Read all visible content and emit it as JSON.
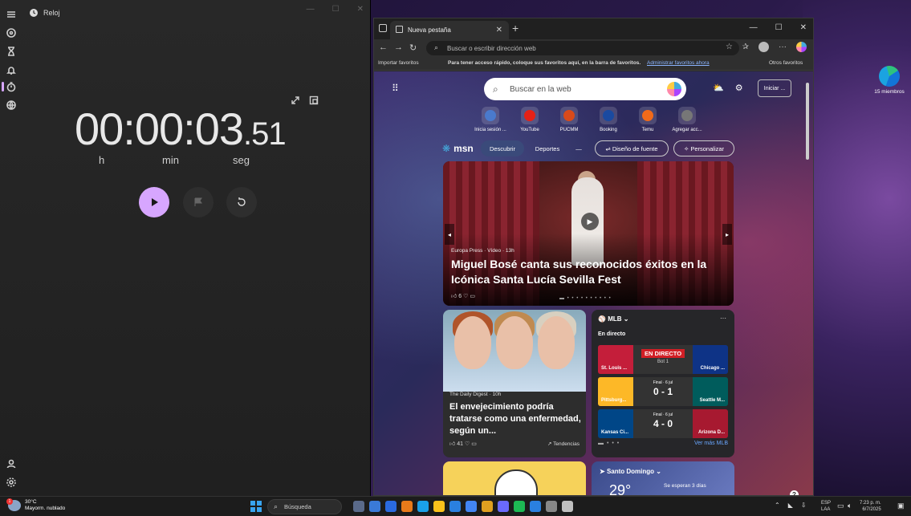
{
  "clock_app": {
    "title": "Reloj",
    "timer": {
      "main": "00:00:03",
      "fraction": ".51"
    },
    "units": {
      "h": "h",
      "min": "min",
      "seg": "seg"
    }
  },
  "browser": {
    "tab_title": "Nueva pestaña",
    "address_placeholder": "Buscar o escribir dirección web",
    "favorites_bar": {
      "import": "Importar favoritos",
      "message": "Para tener acceso rápido, coloque sus favoritos aquí, en la barra de favoritos.",
      "link": "Administrar favoritos ahora",
      "other": "Otros favoritos"
    },
    "search_placeholder": "Buscar en la web",
    "signin_label": "Iniciar ...",
    "quick_links": [
      {
        "label": "Inicia sesión ...",
        "color": "#4a7acc"
      },
      {
        "label": "YouTube",
        "color": "#e62117"
      },
      {
        "label": "PUCMM",
        "color": "#d84a1a"
      },
      {
        "label": "Booking",
        "color": "#1a4aa0"
      },
      {
        "label": "Temu",
        "color": "#f06a1a"
      },
      {
        "label": "Agregar acc...",
        "color": "#777777"
      }
    ],
    "msn": {
      "logo": "msn",
      "tabs": {
        "discover": "Descubrir",
        "sports": "Deportes",
        "more": "—"
      },
      "font_design": "Diseño de fuente",
      "personalize": "Personalizar"
    },
    "hero": {
      "source": "Europa Press · Vídeo · 13h",
      "title": "Miguel Bosé canta sus reconocidos éxitos en la Icónica Santa Lucía Sevilla Fest",
      "reactions": "6"
    },
    "card_article": {
      "source": "The Daily Digest · 10h",
      "title": "El envejecimiento podría tratarse como una enfermedad, según un...",
      "reactions": "41",
      "trend": "Tendencias"
    },
    "mlb": {
      "header": "MLB",
      "live": "En directo",
      "games": [
        {
          "team1": "St. Louis ...",
          "team2": "Chicago ...",
          "status": "EN DIRECTO",
          "sub": "Bot 1",
          "c1": "#c41e3a",
          "c2": "#0e3386"
        },
        {
          "team1": "Pittsburg...",
          "team2": "Seattle M...",
          "status": "Final · 6 jul",
          "score": "0 - 1",
          "c1": "#fdb827",
          "c2": "#005c5c"
        },
        {
          "team1": "Kansas Ci...",
          "team2": "Arizona D...",
          "status": "Final · 6 jul",
          "score": "4 - 0",
          "c1": "#004687",
          "c2": "#a71930"
        }
      ],
      "more": "Ver más MLB"
    },
    "weather_card": {
      "location": "Santo Domingo",
      "temp": "29°",
      "alert": "Se esperan 3 días"
    }
  },
  "desktop": {
    "edge_icon_label": "15 miembros"
  },
  "taskbar": {
    "weather_temp": "30°C",
    "weather_desc": "Mayorm. nublado",
    "search_label": "Búsqueda",
    "lang": "ESP",
    "layout": "LAA",
    "time": "7:23 p. m.",
    "date": "6/7/2025",
    "app_colors": [
      "#5a6a8a",
      "#3a7ad8",
      "#2a6ae0",
      "#e87a1a",
      "#1aa0e8",
      "#fcc21b",
      "#2a80e0",
      "#4285f4",
      "#e0a020",
      "#6a6aff",
      "#1db954",
      "#2a80e0",
      "#888888",
      "#c0c0c0"
    ]
  }
}
